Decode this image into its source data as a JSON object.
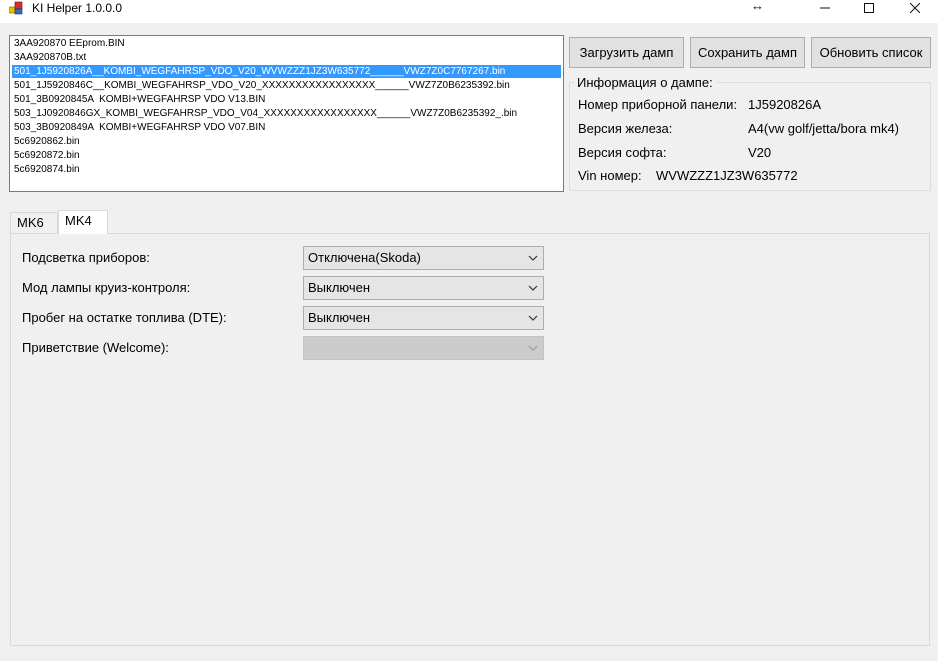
{
  "window": {
    "title": "KI Helper 1.0.0.0",
    "minimize": "—",
    "maximize": "☐",
    "close": "✕",
    "resize_glyph": "↔"
  },
  "files": [
    {
      "name": "3AA920870 EEprom.BIN",
      "selected": false
    },
    {
      "name": "3AA920870B.txt",
      "selected": false
    },
    {
      "name": "501_1J5920826A__KOMBI_WEGFAHRSP_VDO_V20_WVWZZZ1JZ3W635772______VWZ7Z0C7767267.bin",
      "selected": true
    },
    {
      "name": "501_1J5920846C__KOMBI_WEGFAHRSP_VDO_V20_XXXXXXXXXXXXXXXXX______VWZ7Z0B6235392.bin",
      "selected": false
    },
    {
      "name": "501_3B0920845A  KOMBI+WEGFAHRSP VDO V13.BIN",
      "selected": false
    },
    {
      "name": "503_1J0920846GX_KOMBI_WEGFAHRSP_VDO_V04_XXXXXXXXXXXXXXXXX______VWZ7Z0B6235392_.bin",
      "selected": false
    },
    {
      "name": "503_3B0920849A  KOMBI+WEGFAHRSP VDO V07.BIN",
      "selected": false
    },
    {
      "name": "5c6920862.bin",
      "selected": false
    },
    {
      "name": "5c6920872.bin",
      "selected": false
    },
    {
      "name": "5c6920874.bin",
      "selected": false
    }
  ],
  "buttons": {
    "load": "Загрузить дамп",
    "save": "Сохранить дамп",
    "refresh": "Обновить список"
  },
  "info": {
    "legend": "Информация о дампе:",
    "panel_label": "Номер приборной панели:",
    "panel_value": "1J5920826A",
    "hw_label": "Версия железа:",
    "hw_value": "A4(vw golf/jetta/bora mk4)",
    "sw_label": "Версия софта:",
    "sw_value": "V20",
    "vin_label": "Vin номер:",
    "vin_value": "WVWZZZ1JZ3W635772"
  },
  "tabs": [
    {
      "label": "MK6",
      "active": false
    },
    {
      "label": "MK4",
      "active": true
    }
  ],
  "settings": [
    {
      "label": "Подсветка приборов:",
      "value": "Отключена(Skoda)",
      "enabled": true
    },
    {
      "label": "Мод лампы круиз-контроля:",
      "value": "Выключен",
      "enabled": true
    },
    {
      "label": "Пробег на остатке топлива (DTE):",
      "value": "Выключен",
      "enabled": true
    },
    {
      "label": "Приветствие (Welcome):",
      "value": "",
      "enabled": false
    }
  ],
  "colors": {
    "selection": "#3399ff",
    "button_face": "#e1e1e1",
    "window_bg": "#f0f0f0"
  }
}
